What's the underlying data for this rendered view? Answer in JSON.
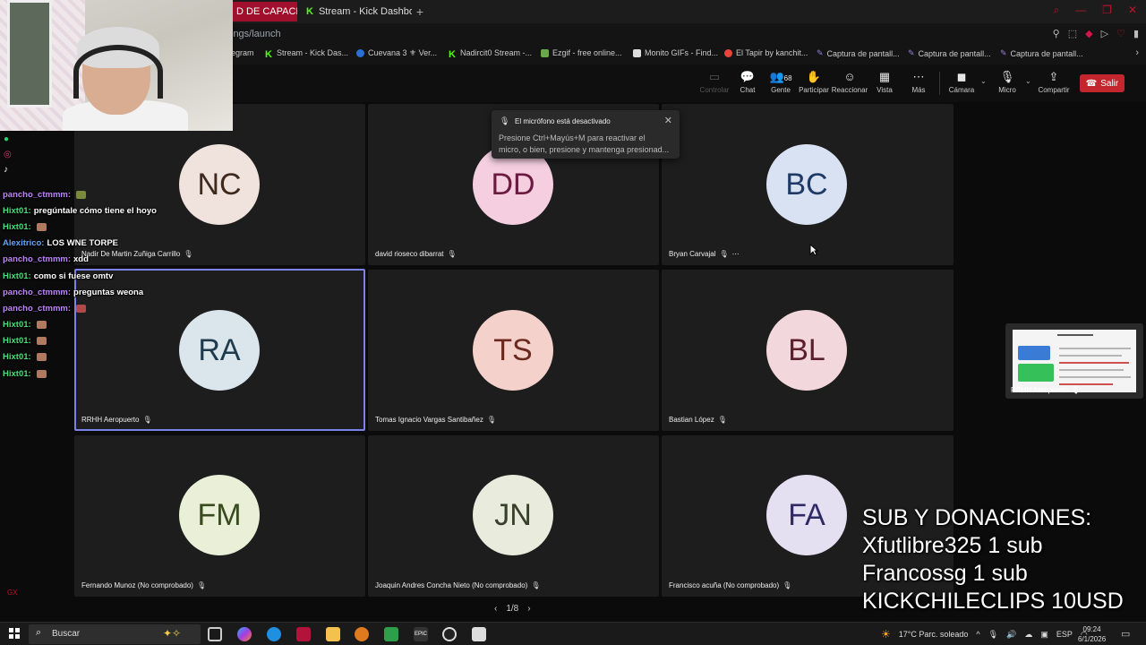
{
  "browser": {
    "tabs": [
      {
        "label": "D DE CAPACITAC"
      },
      {
        "label": "Stream - Kick Dashboard"
      }
    ],
    "new_tab": "+",
    "url": "ings/launch",
    "bookmarks": [
      {
        "label": "egram",
        "color": "#4aa3df"
      },
      {
        "label": "Stream - Kick Das...",
        "color": "#53fc18"
      },
      {
        "label": "Cuevana 3 ⚜ Ver...",
        "color": "#2b6fd6"
      },
      {
        "label": "Nadircit0 Stream -...",
        "color": "#53fc18"
      },
      {
        "label": "Ezgif - free online...",
        "color": "#6aa84f"
      },
      {
        "label": "Monito GIFs - Find...",
        "color": "#dddddd"
      },
      {
        "label": "El Tapir by kanchit...",
        "color": "#e8453c"
      },
      {
        "label": "Captura de pantall...",
        "color": "#9b7fe0"
      },
      {
        "label": "Captura de pantall...",
        "color": "#9b7fe0"
      },
      {
        "label": "Captura de pantall...",
        "color": "#9b7fe0"
      }
    ]
  },
  "toolbar": {
    "controlar": "Controlar",
    "chat": "Chat",
    "gente": "Gente",
    "gente_count": "68",
    "participar": "Participar",
    "reaccionar": "Reaccionar",
    "vista": "Vista",
    "mas": "Más",
    "camara": "Cámara",
    "micro": "Micro",
    "compartir": "Compartir",
    "salir": "Salir"
  },
  "toast": {
    "title": "El micrófono está desactivado",
    "line1": "Presione Ctrl+Mayús+M para reactivar el",
    "line2": "micro, o bien, presione y mantenga presionad..."
  },
  "participants": [
    {
      "initials": "NC",
      "name": "Nadir De Martin Zuñiga Carrillo",
      "bg": "#f0e2dc",
      "fg": "#3f2a20"
    },
    {
      "initials": "DD",
      "name": "david rioseco dibarrat",
      "bg": "#f5cfe0",
      "fg": "#6b1a40"
    },
    {
      "initials": "BC",
      "name": "Bryan Carvajal",
      "bg": "#d9e2f2",
      "fg": "#1f3a66"
    },
    {
      "initials": "RA",
      "name": "RRHH Aeropuerto",
      "bg": "#dbe5ec",
      "fg": "#1f3a4c"
    },
    {
      "initials": "TS",
      "name": "Tomas Ignacio Vargas Santibañez",
      "bg": "#f4d2cb",
      "fg": "#6b2a1f"
    },
    {
      "initials": "BL",
      "name": "Bastian López",
      "bg": "#f2d8dc",
      "fg": "#5a1f2a"
    },
    {
      "initials": "FM",
      "name": "Fernando Munoz (No comprobado)",
      "bg": "#eaf0d8",
      "fg": "#3a4a1f"
    },
    {
      "initials": "JN",
      "name": "Joaquin Andres Concha Nieto (No comprobado)",
      "bg": "#e9ebdd",
      "fg": "#3a3f2a"
    },
    {
      "initials": "FA",
      "name": "Francisco acuña (No comprobado)",
      "bg": "#e4e0f2",
      "fg": "#2f2a66"
    }
  ],
  "pagination": {
    "label": "1/8",
    "prev": "‹",
    "next": "›"
  },
  "share": {
    "label": "RRHH Aeropuerto"
  },
  "chat": [
    {
      "user": "pancho_ctmmm:",
      "text": "",
      "color": "#c084fc",
      "emote": "#7a8a3a"
    },
    {
      "user": "Hixt01:",
      "text": "pregúntale cómo tiene el hoyo",
      "color": "#4ade80",
      "emote": ""
    },
    {
      "user": "Hixt01:",
      "text": "",
      "color": "#4ade80",
      "emote": "#b07a60"
    },
    {
      "user": "Alexitrico:",
      "text": "LOS WNE TORPE",
      "color": "#60a5fa",
      "emote": ""
    },
    {
      "user": "pancho_ctmmm:",
      "text": "xdd",
      "color": "#c084fc",
      "emote": ""
    },
    {
      "user": "Hixt01:",
      "text": "como si fuese omtv",
      "color": "#4ade80",
      "emote": ""
    },
    {
      "user": "pancho_ctmmm:",
      "text": "preguntas weona",
      "color": "#c084fc",
      "emote": ""
    },
    {
      "user": "pancho_ctmmm:",
      "text": "",
      "color": "#c084fc",
      "emote": "#b04a4a"
    },
    {
      "user": "Hixt01:",
      "text": "",
      "color": "#4ade80",
      "emote": "#b07a60"
    },
    {
      "user": "Hixt01:",
      "text": "",
      "color": "#4ade80",
      "emote": "#b07a60"
    },
    {
      "user": "Hixt01:",
      "text": "",
      "color": "#4ade80",
      "emote": "#b07a60"
    },
    {
      "user": "Hixt01:",
      "text": "",
      "color": "#4ade80",
      "emote": "#b07a60"
    }
  ],
  "overlay": {
    "subs_title": "SUB Y DONACIONES:",
    "sub1": "Xfutlibre325 1 sub",
    "sub2": "Francossg 1 sub",
    "sub3": "KICKCHILECLIPS 10USD",
    "gx": "GX"
  },
  "taskbar": {
    "search_placeholder": "Buscar",
    "weather": "17°C  Parc. soleado",
    "lang": "ESP",
    "time": "09:24",
    "date": "6/1/2026"
  },
  "colors": {
    "accent": "#7b83eb",
    "salir": "#c4262e",
    "kick": "#53fc18",
    "tab_active": "#a0102c"
  }
}
